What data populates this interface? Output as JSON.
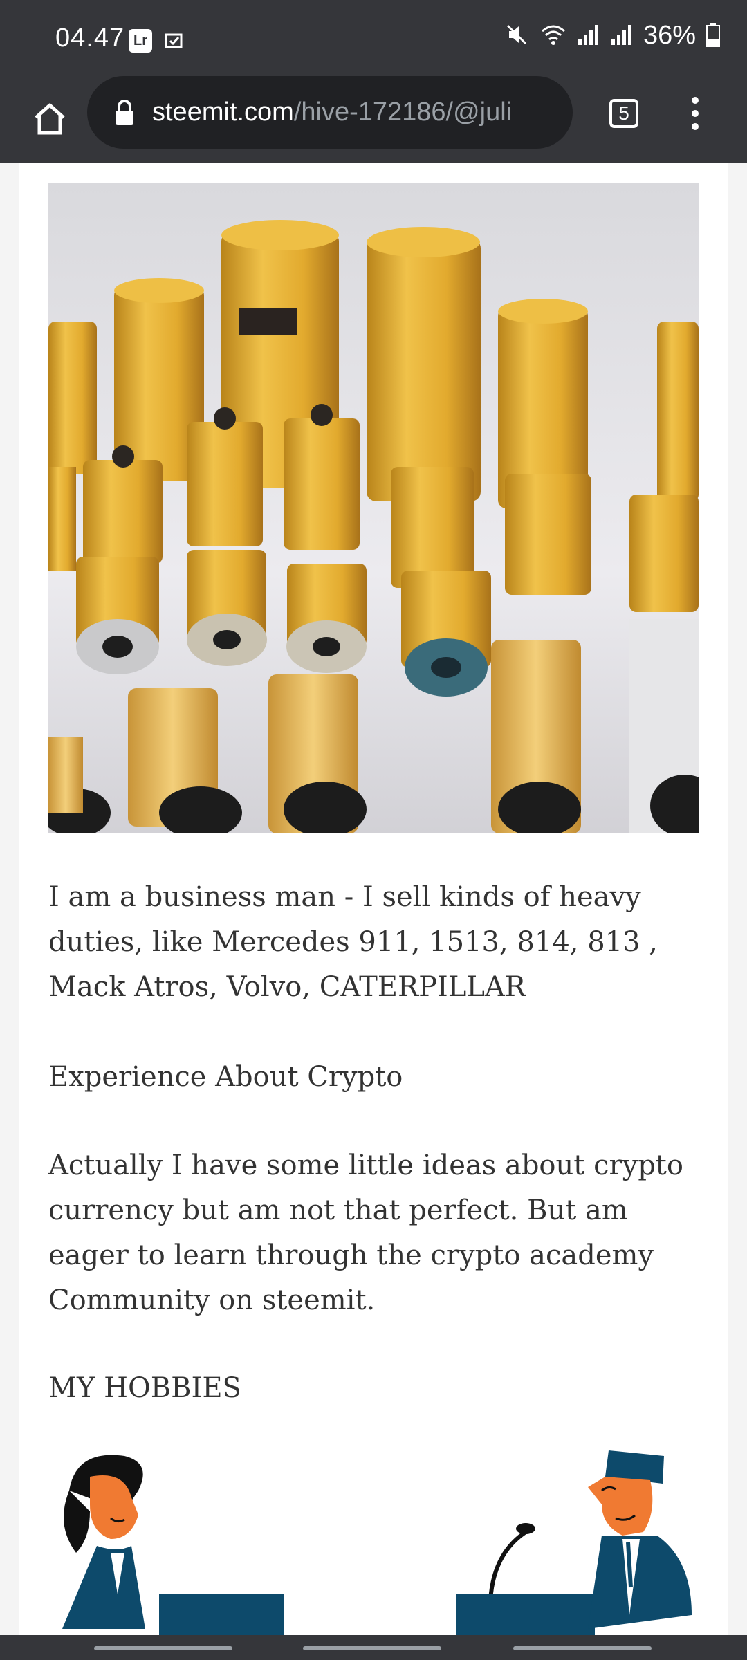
{
  "status_bar": {
    "time": "04.47",
    "app_badge": "Lr",
    "battery": "36%",
    "icons": [
      "lightroom-icon",
      "notification-icon",
      "mute-icon",
      "wifi-icon",
      "signal-icon",
      "signal-icon",
      "battery-icon"
    ]
  },
  "browser": {
    "url_domain": "steemit.com",
    "url_path": "/hive-172186/@juli",
    "tab_count": "5",
    "icons": [
      "home-icon",
      "lock-icon",
      "tabs-icon",
      "more-vert-icon"
    ]
  },
  "post": {
    "image_alt": "yellow filter products",
    "paragraph_business": "I am a business man - I sell kinds of heavy duties, like Mercedes 911, 1513, 814, 813 , Mack Atros, Volvo, CATERPILLAR",
    "heading_crypto": "Experience About Crypto",
    "paragraph_crypto": "Actually I have some little ideas about crypto currency but am not that perfect. But am eager to learn through the crypto academy Community on steemit.",
    "heading_hobbies": "MY HOBBIES"
  },
  "colors": {
    "chrome": "#35363a",
    "urlbar": "#202124",
    "text": "#333333",
    "filter_yellow": "#e8b53a",
    "illustration_blue": "#0d4a6b",
    "illustration_orange": "#f07a32"
  }
}
